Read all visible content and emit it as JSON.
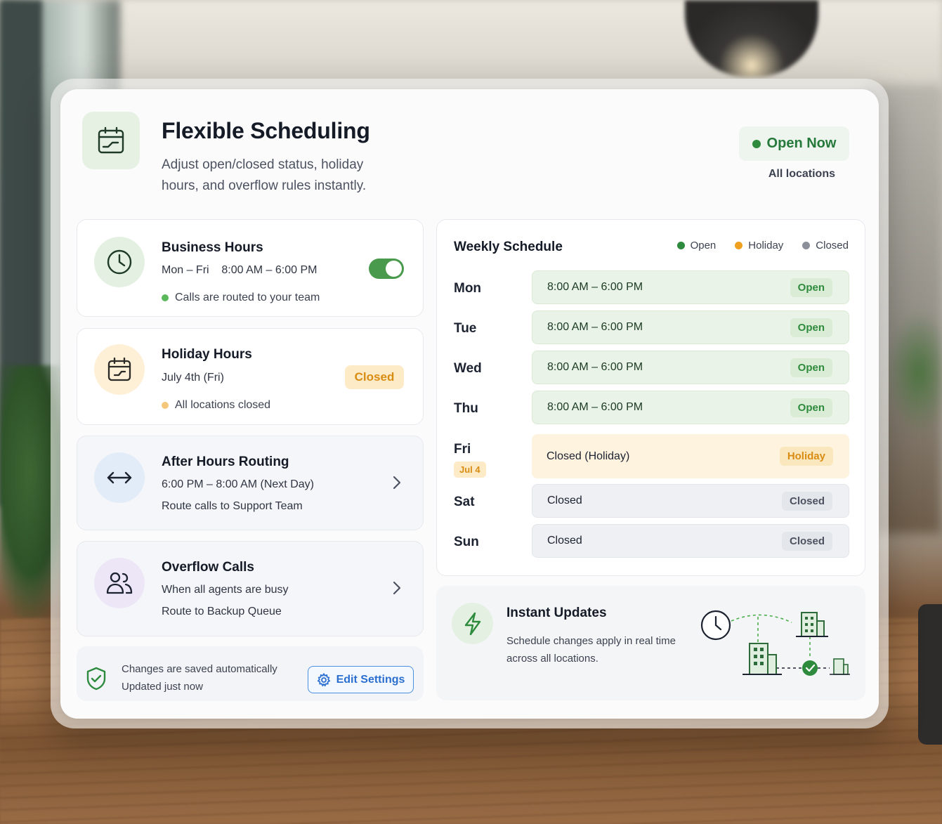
{
  "header": {
    "title": "Flexible Scheduling",
    "subtitle": "Adjust open/closed status, holiday hours, and overflow rules instantly.",
    "status_label": "Open Now",
    "status_scope": "All locations",
    "status_color": "#2e8b3e"
  },
  "business_hours": {
    "title": "Business Hours",
    "days": "Mon – Fri",
    "hours": "8:00 AM – 6:00 PM",
    "note": "Calls are routed to your team",
    "enabled": true
  },
  "holiday_hours": {
    "title": "Holiday Hours",
    "date": "July 4th (Fri)",
    "status": "Closed",
    "note": "All locations closed"
  },
  "after_hours": {
    "title": "After Hours Routing",
    "hours": "6:00 PM – 8:00 AM (Next Day)",
    "route": "Route calls to Support Team"
  },
  "overflow": {
    "title": "Overflow Calls",
    "condition": "When all agents are busy",
    "route": "Route to Backup Queue"
  },
  "footer": {
    "line1": "Changes are saved automatically",
    "line2": "Updated just now",
    "edit_label": "Edit Settings"
  },
  "weekly": {
    "title": "Weekly Schedule",
    "legend": [
      {
        "label": "Open",
        "color": "#2e8b3e"
      },
      {
        "label": "Holiday",
        "color": "#f0a020"
      },
      {
        "label": "Closed",
        "color": "#8a8f99"
      }
    ],
    "days": [
      {
        "day": "Mon",
        "time": "8:00 AM – 6:00 PM",
        "badge": "Open",
        "kind": "open"
      },
      {
        "day": "Tue",
        "time": "8:00 AM – 6:00 PM",
        "badge": "Open",
        "kind": "open"
      },
      {
        "day": "Wed",
        "time": "8:00 AM – 6:00 PM",
        "badge": "Open",
        "kind": "open"
      },
      {
        "day": "Thu",
        "time": "8:00 AM – 6:00 PM",
        "badge": "Open",
        "kind": "open"
      },
      {
        "day": "Fri",
        "tag": "Jul 4",
        "time": "Closed (Holiday)",
        "badge": "Holiday",
        "kind": "holiday"
      },
      {
        "day": "Sat",
        "time": "Closed",
        "badge": "Closed",
        "kind": "closed"
      },
      {
        "day": "Sun",
        "time": "Closed",
        "badge": "Closed",
        "kind": "closed"
      }
    ]
  },
  "instant_updates": {
    "title": "Instant Updates",
    "text": "Schedule changes apply in real time across all locations."
  }
}
